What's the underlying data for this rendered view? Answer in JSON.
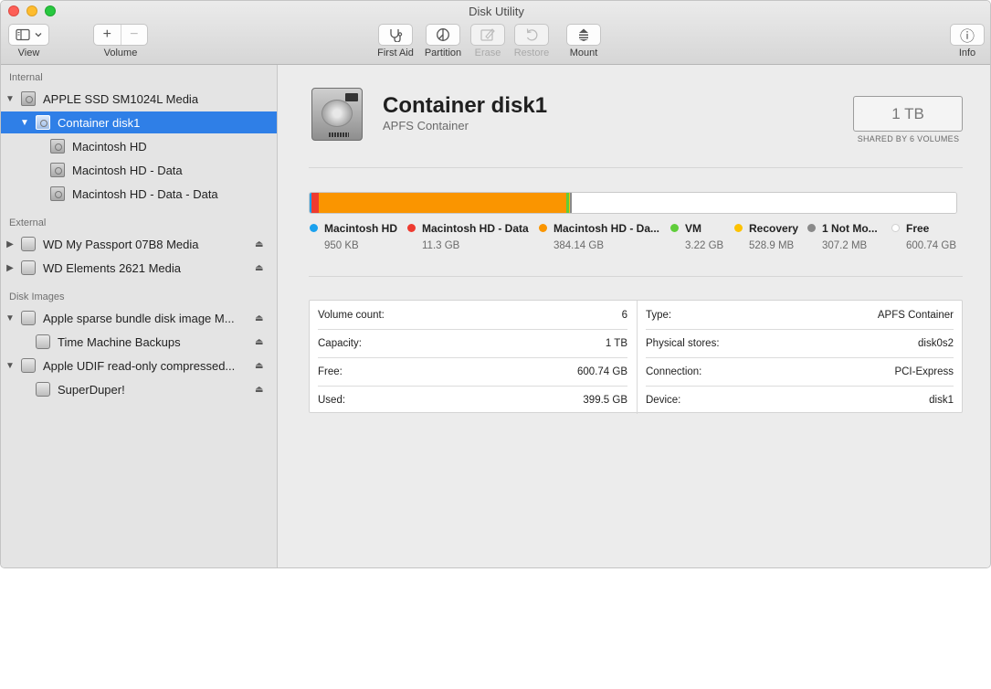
{
  "window": {
    "title": "Disk Utility"
  },
  "toolbar": {
    "view_label": "View",
    "volume_label": "Volume",
    "volume_add": "+",
    "volume_remove": "−",
    "first_aid_label": "First Aid",
    "partition_label": "Partition",
    "erase_label": "Erase",
    "restore_label": "Restore",
    "mount_label": "Mount",
    "info_label": "Info",
    "info_icon_glyph": "ⓘ",
    "disabled": [
      "Erase",
      "Restore"
    ]
  },
  "sidebar": {
    "sections": {
      "internal": "Internal",
      "external": "External",
      "disk_images": "Disk Images"
    },
    "items": [
      {
        "label": "APPLE SSD SM1024L Media",
        "disclosure": "▼"
      },
      {
        "label": "Container disk1",
        "disclosure": "▼",
        "selected": true
      },
      {
        "label": "Macintosh HD"
      },
      {
        "label": "Macintosh HD - Data"
      },
      {
        "label": "Macintosh HD - Data - Data"
      },
      {
        "label": "WD My Passport 07B8 Media",
        "disclosure": "▶",
        "eject": "⏏"
      },
      {
        "label": "WD Elements 2621 Media",
        "disclosure": "▶",
        "eject": "⏏"
      },
      {
        "label": "Apple sparse bundle disk image M...",
        "disclosure": "▼",
        "eject": "⏏"
      },
      {
        "label": "Time Machine Backups",
        "eject": "⏏"
      },
      {
        "label": "Apple UDIF read-only compressed...",
        "disclosure": "▼",
        "eject": "⏏"
      },
      {
        "label": "SuperDuper!",
        "eject": "⏏"
      }
    ],
    "selection_color": "#2f7fe7"
  },
  "main": {
    "name": "Container disk1",
    "subtitle": "APFS Container",
    "capacity": "1 TB",
    "capacity_caption": "SHARED BY 6 VOLUMES",
    "usage_segments": [
      {
        "name": "Macintosh HD",
        "fraction": 1e-06,
        "color": "#1aa1ee"
      },
      {
        "name": "Macintosh HD - Data",
        "fraction": 0.0113,
        "color": "#ee3b30"
      },
      {
        "name": "Macintosh HD - Data",
        "fraction": 0.3841,
        "color": "#fa9500"
      },
      {
        "name": "VM",
        "fraction": 0.0032,
        "color": "#5fcd3a"
      },
      {
        "name": "Recovery",
        "fraction": 0.0005,
        "color": "#fdc201"
      },
      {
        "name": "1 Not Mounted",
        "fraction": 0.0003,
        "color": "#8a8a8a"
      },
      {
        "name": "Free",
        "fraction": 0.6007,
        "color": "#ffffff"
      }
    ],
    "legend": [
      {
        "name": "Macintosh HD",
        "value": "950 KB",
        "color": "#1aa1ee"
      },
      {
        "name": "Macintosh HD - Data",
        "value": "11.3 GB",
        "color": "#ee3b30"
      },
      {
        "name": "Macintosh HD - Da...",
        "value": "384.14 GB",
        "color": "#fa9500"
      },
      {
        "name": "VM",
        "value": "3.22 GB",
        "color": "#5fcd3a"
      },
      {
        "name": "Recovery",
        "value": "528.9 MB",
        "color": "#fdc201"
      },
      {
        "name": "1 Not Mo...",
        "value": "307.2 MB",
        "color": "#8a8a8a"
      },
      {
        "name": "Free",
        "value": "600.74 GB",
        "color": "#ffffff"
      }
    ],
    "info_left": [
      {
        "key": "Volume count:",
        "value": "6"
      },
      {
        "key": "Capacity:",
        "value": "1 TB"
      },
      {
        "key": "Free:",
        "value": "600.74 GB"
      },
      {
        "key": "Used:",
        "value": "399.5 GB"
      }
    ],
    "info_right": [
      {
        "key": "Type:",
        "value": "APFS Container"
      },
      {
        "key": "Physical stores:",
        "value": "disk0s2"
      },
      {
        "key": "Connection:",
        "value": "PCI-Express"
      },
      {
        "key": "Device:",
        "value": "disk1"
      }
    ]
  }
}
